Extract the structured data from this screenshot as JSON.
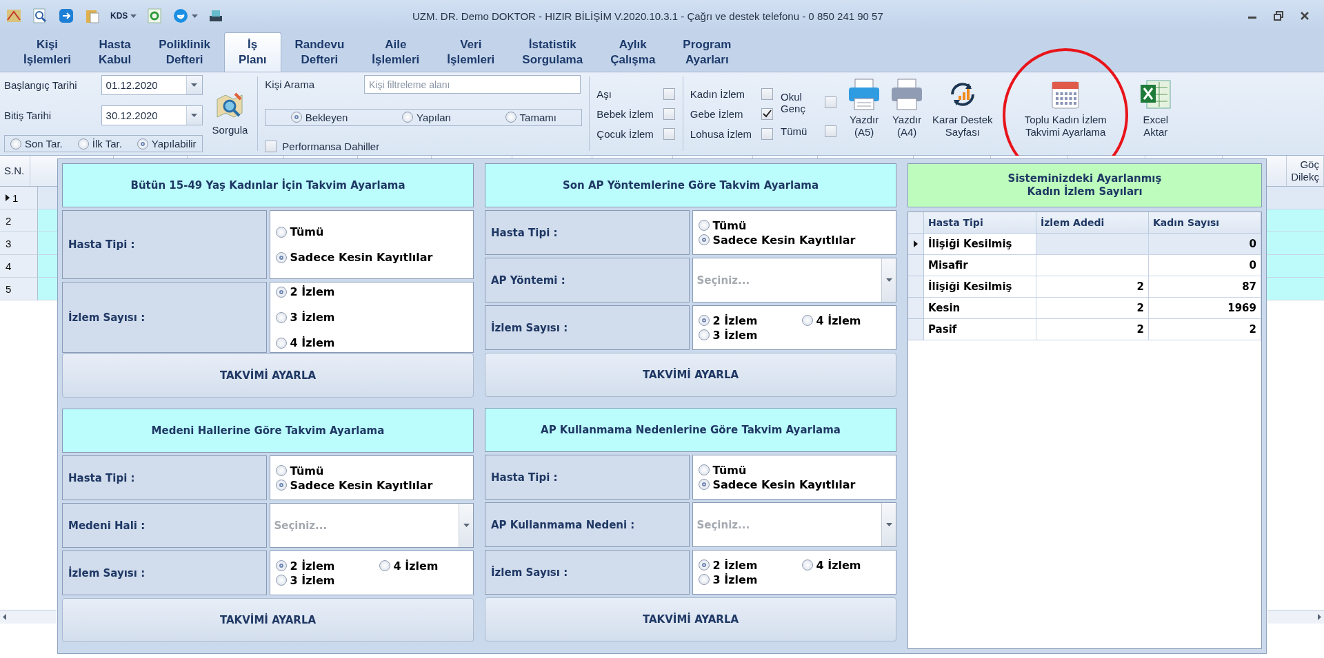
{
  "window": {
    "title": "UZM. DR. Demo DOKTOR - HIZIR BİLİŞİM V.2020.10.3.1 - Çağrı ve destek telefonu - 0 850 241 90 57"
  },
  "quick_access": [
    {
      "kind": "map"
    },
    {
      "kind": "search"
    },
    {
      "kind": "remote"
    },
    {
      "kind": "clipboard"
    },
    {
      "kind": "text",
      "label": "KDS",
      "dropdown": true
    },
    {
      "kind": "recycle"
    },
    {
      "kind": "browser",
      "dropdown": true
    },
    {
      "kind": "scanner"
    }
  ],
  "tabs": [
    {
      "lines": [
        "Kişi",
        "İşlemleri"
      ],
      "selected": false
    },
    {
      "lines": [
        "Hasta",
        "Kabul"
      ],
      "selected": false
    },
    {
      "lines": [
        "Poliklinik",
        "Defteri"
      ],
      "selected": false
    },
    {
      "lines": [
        "İş",
        "Planı"
      ],
      "selected": true
    },
    {
      "lines": [
        "Randevu",
        "Defteri"
      ],
      "selected": false
    },
    {
      "lines": [
        "Aile",
        "İşlemleri"
      ],
      "selected": false
    },
    {
      "lines": [
        "Veri",
        "İşlemleri"
      ],
      "selected": false
    },
    {
      "lines": [
        "İstatistik",
        "Sorgulama"
      ],
      "selected": false
    },
    {
      "lines": [
        "Aylık",
        "Çalışma"
      ],
      "selected": false
    },
    {
      "lines": [
        "Program",
        "Ayarları"
      ],
      "selected": false
    }
  ],
  "dates": [
    {
      "label": "Başlangıç Tarihi",
      "value": "01.12.2020"
    },
    {
      "label": "Bitiş Tarihi",
      "value": "30.12.2020"
    }
  ],
  "date_mode": [
    {
      "label": "Son Tar.",
      "selected": false
    },
    {
      "label": "İlk Tar.",
      "selected": false
    },
    {
      "label": "Yapılabilir",
      "selected": true
    }
  ],
  "query_button": {
    "label": "Sorgula"
  },
  "person_search": {
    "label": "Kişi Arama",
    "placeholder": "Kişi filtreleme alanı",
    "status": [
      {
        "label": "Bekleyen",
        "selected": true
      },
      {
        "label": "Yapılan",
        "selected": false
      },
      {
        "label": "Tamamı",
        "selected": false
      }
    ],
    "performance": {
      "label": "Performansa Dahiller",
      "checked": false
    }
  },
  "filter_columns": [
    [
      {
        "label": "Aşı",
        "checked": false
      },
      {
        "label": "Bebek İzlem",
        "checked": false
      },
      {
        "label": "Çocuk İzlem",
        "checked": false
      }
    ],
    [
      {
        "label": "Kadın İzlem",
        "checked": false
      },
      {
        "label": "Gebe İzlem",
        "checked": true
      },
      {
        "label": "Lohusa İzlem",
        "checked": false
      }
    ],
    [
      {
        "label": "Okul Genç",
        "checked": false
      },
      {
        "label": "Tümü",
        "checked": false
      }
    ]
  ],
  "actions": [
    {
      "kind": "printer-color",
      "lines": [
        "Yazdır",
        "(A5)"
      ]
    },
    {
      "kind": "printer",
      "lines": [
        "Yazdır",
        "(A4)"
      ]
    },
    {
      "kind": "chart-refresh",
      "lines": [
        "Karar Destek",
        "Sayfası"
      ]
    },
    {
      "kind": "calendar",
      "lines": [
        "Toplu Kadın İzlem",
        "Takvimi Ayarlama"
      ],
      "circled": true
    },
    {
      "kind": "excel",
      "lines": [
        "Excel",
        "Aktar"
      ]
    }
  ],
  "grid": {
    "sn_header": "S.N.",
    "last_header": [
      "Göç",
      "Dilekç"
    ],
    "rows": [
      {
        "sn": "1",
        "selected": true
      },
      {
        "sn": "2",
        "selected": false
      },
      {
        "sn": "3",
        "selected": false
      },
      {
        "sn": "4",
        "selected": false
      },
      {
        "sn": "5",
        "selected": false
      }
    ]
  },
  "sections": [
    {
      "title": "Bütün 15-49 Yaş Kadınlar İçin Takvim Ayarlama",
      "rows": [
        {
          "label": "Hasta Tipi :",
          "kind": "radio-list",
          "options": [
            {
              "label": "Tümü",
              "selected": false
            },
            {
              "label": "Sadece Kesin Kayıtlılar",
              "selected": true
            }
          ]
        },
        {
          "label": "İzlem Sayısı :",
          "kind": "radio-list",
          "options": [
            {
              "label": "2 İzlem",
              "selected": true
            },
            {
              "label": "3 İzlem",
              "selected": false
            },
            {
              "label": "4 İzlem",
              "selected": false
            }
          ]
        }
      ],
      "button": "TAKVİMİ AYARLA"
    },
    {
      "title": "Son AP Yöntemlerine Göre Takvim Ayarlama",
      "rows": [
        {
          "label": "Hasta Tipi :",
          "kind": "radio-list",
          "options": [
            {
              "label": "Tümü",
              "selected": false
            },
            {
              "label": "Sadece Kesin Kayıtlılar",
              "selected": true
            }
          ]
        },
        {
          "label": "AP Yöntemi :",
          "kind": "select",
          "placeholder": "Seçiniz..."
        },
        {
          "label": "İzlem Sayısı :",
          "kind": "radio-grid",
          "options": [
            {
              "label": "2 İzlem",
              "selected": true
            },
            {
              "label": "3 İzlem",
              "selected": false
            },
            {
              "label": "4 İzlem",
              "selected": false
            }
          ]
        }
      ],
      "button": "TAKVİMİ AYARLA"
    },
    {
      "title": "Medeni Hallerine Göre Takvim Ayarlama",
      "rows": [
        {
          "label": "Hasta Tipi :",
          "kind": "radio-list",
          "options": [
            {
              "label": "Tümü",
              "selected": false
            },
            {
              "label": "Sadece Kesin Kayıtlılar",
              "selected": true
            }
          ]
        },
        {
          "label": "Medeni Hali :",
          "kind": "select",
          "placeholder": "Seçiniz..."
        },
        {
          "label": "İzlem Sayısı :",
          "kind": "radio-grid",
          "options": [
            {
              "label": "2 İzlem",
              "selected": true
            },
            {
              "label": "3 İzlem",
              "selected": false
            },
            {
              "label": "4 İzlem",
              "selected": false
            }
          ]
        }
      ],
      "button": "TAKVİMİ AYARLA"
    },
    {
      "title": "AP Kullanmama Nedenlerine Göre Takvim Ayarlama",
      "rows": [
        {
          "label": "Hasta Tipi :",
          "kind": "radio-list",
          "options": [
            {
              "label": "Tümü",
              "selected": false
            },
            {
              "label": "Sadece Kesin Kayıtlılar",
              "selected": true
            }
          ]
        },
        {
          "label": "AP Kullanmama Nedeni :",
          "kind": "select",
          "placeholder": "Seçiniz..."
        },
        {
          "label": "İzlem Sayısı :",
          "kind": "radio-grid",
          "options": [
            {
              "label": "2 İzlem",
              "selected": true
            },
            {
              "label": "3 İzlem",
              "selected": false
            },
            {
              "label": "4 İzlem",
              "selected": false
            }
          ]
        }
      ],
      "button": "TAKVİMİ AYARLA"
    }
  ],
  "summary": {
    "title_lines": [
      "Sisteminizdeki Ayarlanmış",
      "Kadın İzlem Sayıları"
    ],
    "columns": [
      "Hasta Tipi",
      "İzlem Adedi",
      "Kadın Sayısı"
    ],
    "rows": [
      {
        "cells": [
          "İlişiği Kesilmiş",
          "",
          "0"
        ],
        "selected": true
      },
      {
        "cells": [
          "Misafir",
          "",
          "0"
        ],
        "selected": false
      },
      {
        "cells": [
          "İlişiği Kesilmiş",
          "2",
          "87"
        ],
        "selected": false
      },
      {
        "cells": [
          "Kesin",
          "2",
          "1969"
        ],
        "selected": false
      },
      {
        "cells": [
          "Pasif",
          "2",
          "2"
        ],
        "selected": false
      }
    ]
  }
}
